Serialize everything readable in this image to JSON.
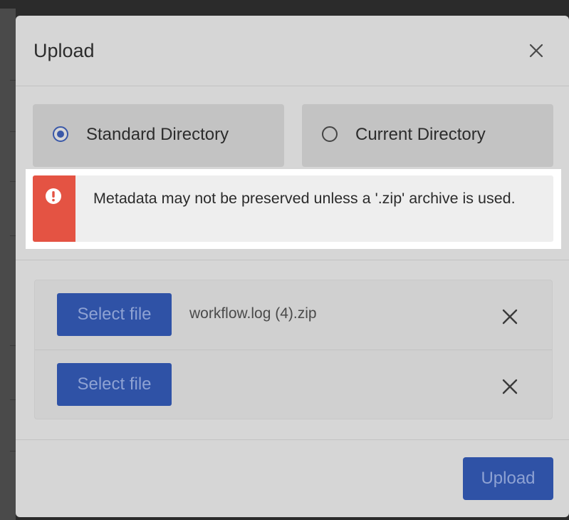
{
  "dialog": {
    "title": "Upload",
    "close_icon": "close-icon"
  },
  "directory_options": [
    {
      "label": "Standard Directory",
      "selected": true
    },
    {
      "label": "Current Directory",
      "selected": false
    }
  ],
  "alert": {
    "icon": "exclamation-circle-icon",
    "message": "Metadata may not be preserved unless a '.zip' archive is used."
  },
  "files": [
    {
      "button_label": "Select file",
      "file_name": "workflow.log (4).zip",
      "remove_icon": "close-icon"
    },
    {
      "button_label": "Select file",
      "file_name": "",
      "remove_icon": "close-icon"
    }
  ],
  "footer": {
    "upload_label": "Upload"
  },
  "colors": {
    "primary": "#2f52a6",
    "danger": "#e45343",
    "radio_checked": "#3a58a8"
  }
}
